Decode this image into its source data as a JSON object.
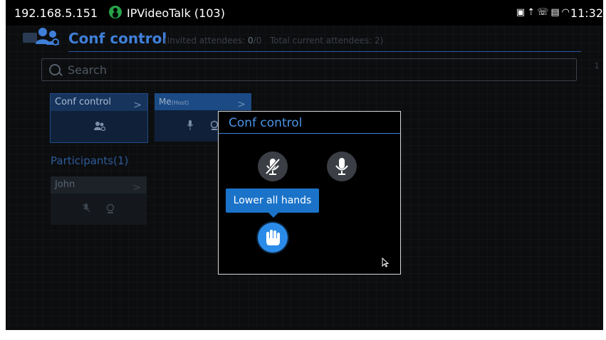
{
  "status_bar": {
    "ip": "192.168.5.151",
    "app": "IPVideoTalk (103)",
    "app_icon": "contact-icon",
    "system_icons": [
      "image-icon",
      "upload-icon",
      "call-icon",
      "sim-icon",
      "wifi-icon"
    ],
    "time": "11:32"
  },
  "header": {
    "title": "Conf control",
    "invited_label": "(Invited attendees:",
    "invited_value": "0",
    "invited_total": "/0",
    "total_label": "Total current attendees:",
    "total_value": "2)"
  },
  "search": {
    "placeholder": "Search"
  },
  "right_stub": "1",
  "cards": {
    "conf_control": {
      "label": "Conf control"
    },
    "me": {
      "label": "Me",
      "tag": "(Host)"
    }
  },
  "participants": {
    "heading": "Participants(1)",
    "items": [
      {
        "name": "John"
      }
    ]
  },
  "dialog": {
    "title": "Conf control",
    "actions": [
      {
        "name": "mute-all",
        "icon": "mic-muted-icon"
      },
      {
        "name": "unmute-all",
        "icon": "mic-icon"
      },
      {
        "name": "lower-all-hands",
        "icon": "hand-icon",
        "tooltip": "Lower all hands"
      }
    ]
  },
  "colors": {
    "accent": "#3f7fd8",
    "dialog_title": "#4a94e6",
    "tooltip": "#1b73c9",
    "active_button": "#2b8be8"
  }
}
